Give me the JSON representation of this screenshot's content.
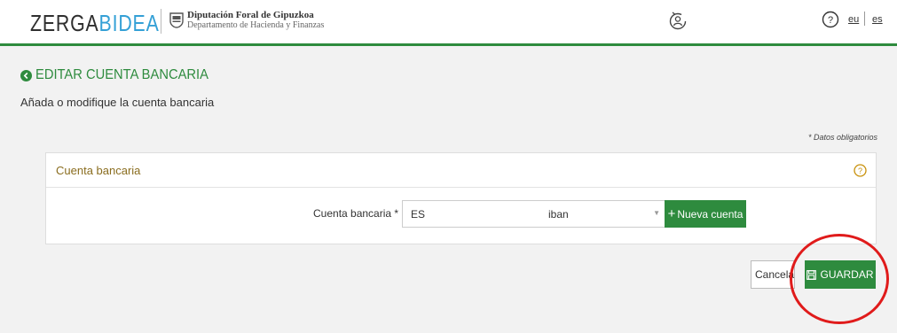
{
  "header": {
    "logo_part1": "ZERGA",
    "logo_part2": "BIDEA",
    "org_title": "Diputación Foral de Gipuzkoa",
    "org_subtitle": "Departamento de Hacienda y Finanzas",
    "lang_eu": "eu",
    "lang_es": "es",
    "user_icon": "user-refresh-icon",
    "help_icon": "help-circle-icon"
  },
  "page": {
    "title": "EDITAR CUENTA BANCARIA",
    "subtitle": "Añada o modifique la cuenta bancaria",
    "required_note": "* Datos obligatorios"
  },
  "panel": {
    "title": "Cuenta bancaria",
    "field_label": "Cuenta bancaria *",
    "select_value": "ES ",
    "select_suffix": "iban",
    "new_account_label": "Nueva cuenta"
  },
  "actions": {
    "cancel_label": "Cancelar",
    "save_label": "GUARDAR"
  },
  "colors": {
    "accent_green": "#2e8b3e",
    "panel_title": "#8a6d1f",
    "highlight_red": "#e01b1b",
    "logo_blue": "#34a0d6"
  }
}
